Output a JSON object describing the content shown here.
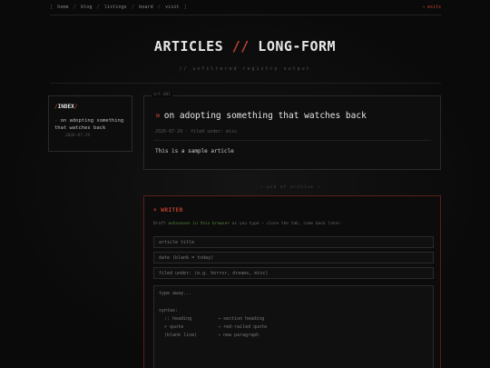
{
  "nav": {
    "items": [
      "home",
      "blog",
      "listings",
      "board",
      "visit"
    ],
    "open_bracket": "[",
    "close_bracket": "]",
    "separator": "/",
    "exits": "→ exits"
  },
  "header": {
    "title_left": "ARTICLES",
    "title_slash": "//",
    "title_right": "LONG-FORM",
    "subtitle": "// unfiltered registry output"
  },
  "index": {
    "title_prefix": "/",
    "title": "INDEX",
    "title_suffix": "/",
    "items": [
      {
        "dash": "-",
        "label": "on adopting something that watches back",
        "date": "2026-07-29"
      }
    ]
  },
  "article": {
    "tag": "art.001",
    "chevron": "»",
    "title": "on adopting something that watches back",
    "meta": "2026-07-29 · filed under: misc",
    "body": "This is a sample article"
  },
  "endmark": "— end of archive —",
  "writer": {
    "title": "+ WRITER",
    "hint_before": "Draft ",
    "hint_highlight": "autosaves in this browser",
    "hint_after": " as you type — close the tab, come back later.",
    "fields": {
      "title_placeholder": "article title",
      "date_placeholder": "date (blank = today)",
      "filed_placeholder": "filed under: (e.g. horror, dreams, misc)"
    },
    "body_placeholder": "type away...",
    "syntax_label": "syntax:",
    "syntax_rows": [
      {
        "key": "  :: heading",
        "desc": "→ section heading"
      },
      {
        "key": "  > quote",
        "desc": "→ red-railed quote"
      },
      {
        "key": "  (blank line)",
        "desc": "→ new paragraph"
      }
    ]
  }
}
